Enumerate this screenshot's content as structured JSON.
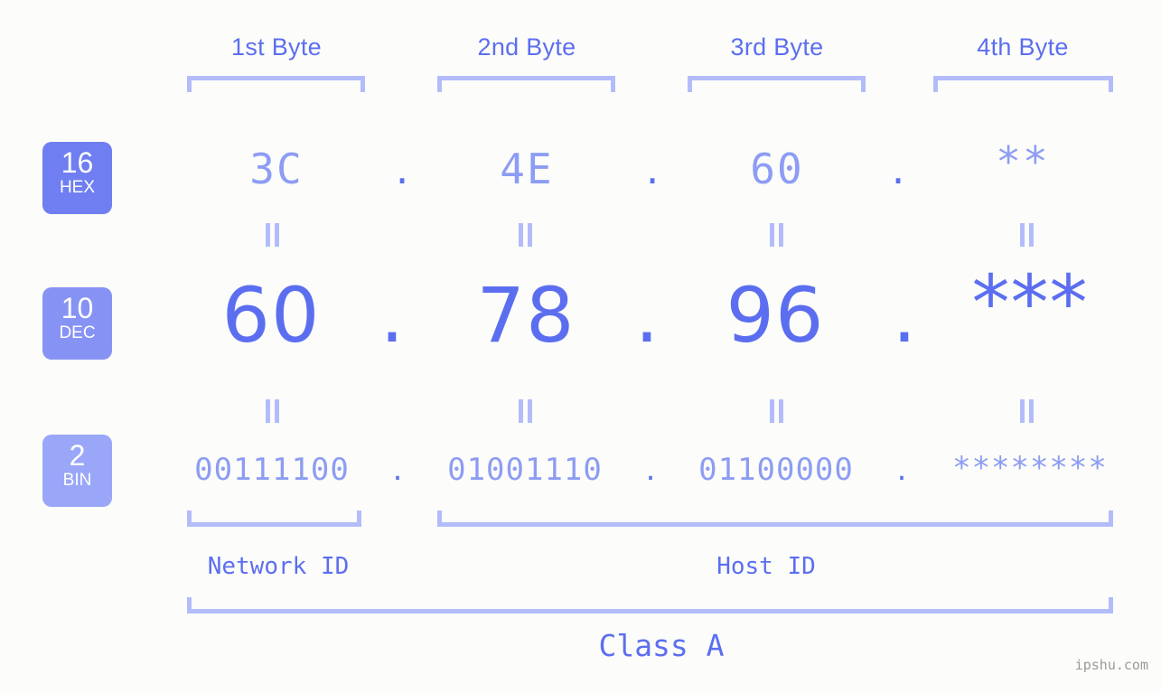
{
  "background": "#fcfdfa",
  "colors": {
    "accent_dark": "#5c6ef0",
    "accent_light": "#8d9cf4",
    "bracket": "#b3bcfa",
    "badge_hex": "#6f7ef0",
    "badge_dec": "#8693f4",
    "badge_bin": "#9aa6f8",
    "watermark": "#999999"
  },
  "byte_headers": [
    {
      "label": "1st Byte"
    },
    {
      "label": "2nd Byte"
    },
    {
      "label": "3rd Byte"
    },
    {
      "label": "4th Byte"
    }
  ],
  "bases": [
    {
      "number": "16",
      "name": "HEX"
    },
    {
      "number": "10",
      "name": "DEC"
    },
    {
      "number": "2",
      "name": "BIN"
    }
  ],
  "rows": {
    "hex": {
      "values": [
        "3C",
        "4E",
        "60",
        "**"
      ]
    },
    "dec": {
      "values": [
        "60",
        "78",
        "96",
        "***"
      ]
    },
    "bin": {
      "values": [
        "00111100",
        "01001110",
        "01100000",
        "********"
      ]
    }
  },
  "separator": ".",
  "equals_symbol": "||",
  "footer": {
    "network_id": "Network ID",
    "host_id": "Host ID",
    "class_label": "Class A"
  },
  "watermark": "ipshu.com"
}
